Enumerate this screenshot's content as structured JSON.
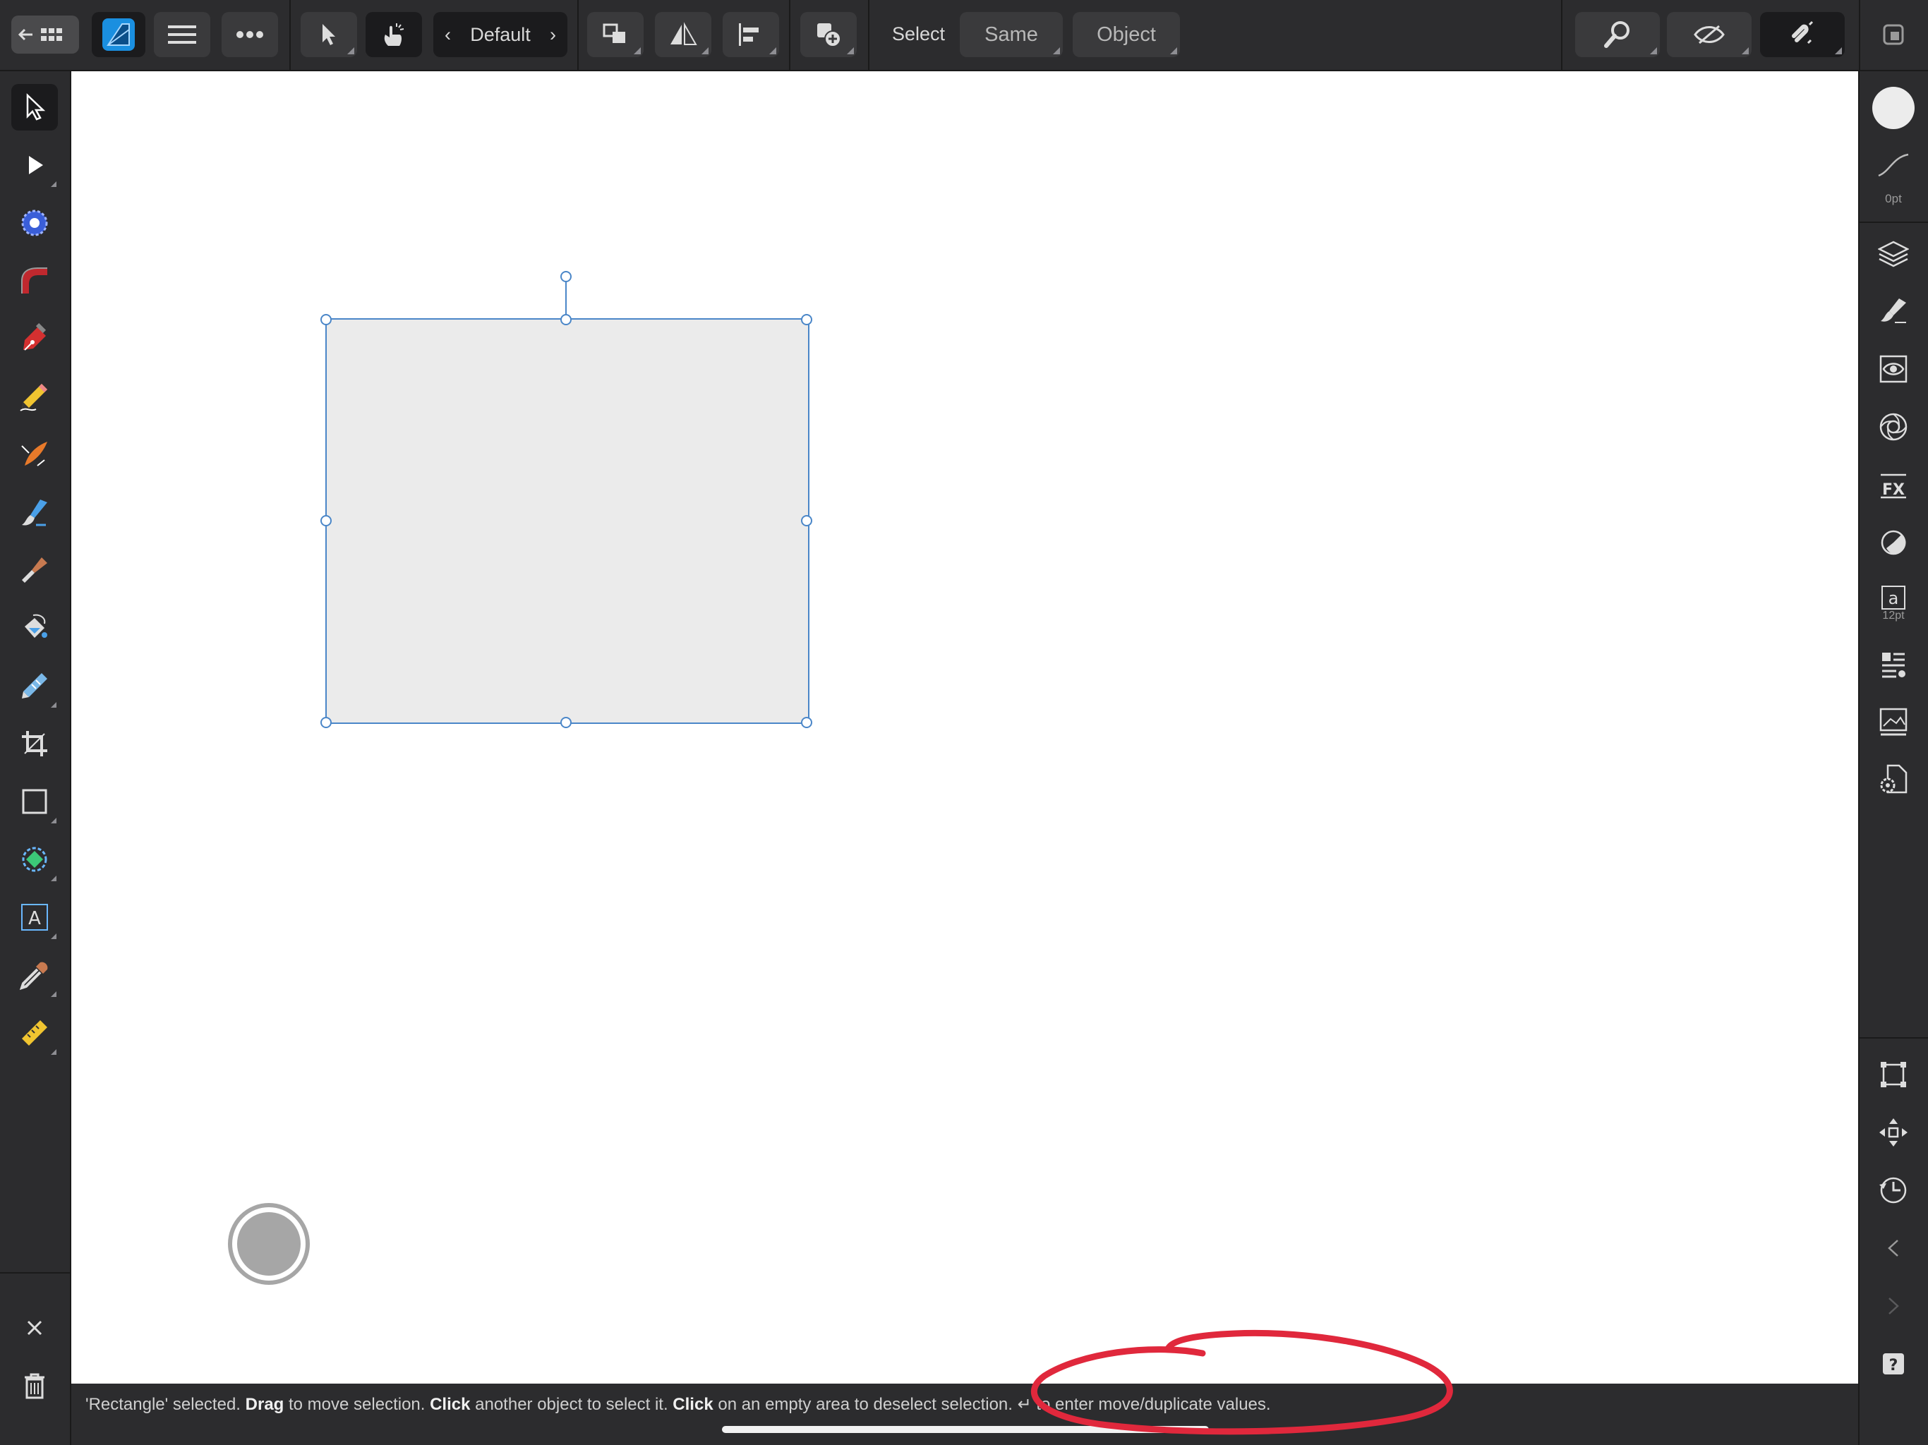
{
  "toolbar": {
    "context_label": "Default",
    "select_label": "Select",
    "same_label": "Same",
    "object_label": "Object"
  },
  "left_tools": [
    "move-tool",
    "node-tool",
    "corner-tool",
    "point-transform-tool",
    "pen-tool",
    "pencil-tool",
    "vector-brush-tool",
    "fill-tool",
    "paint-brush-tool",
    "transparency-tool",
    "shape-builder-tool",
    "crop-tool",
    "rectangle-tool",
    "vector-crop-tool",
    "artistic-text-tool",
    "color-picker-tool",
    "measure-tool"
  ],
  "right_panel": {
    "stroke_width": "0pt",
    "text_size": "12pt"
  },
  "canvas": {
    "selected_object": "Rectangle",
    "rect_fill": "#ebebeb",
    "selection_color": "#4a86c8"
  },
  "status": {
    "p1": "'Rectangle' selected. ",
    "b1": "Drag",
    "p2": " to move selection. ",
    "b2": "Click",
    "p3": " another object to select it. ",
    "b3": "Click",
    "p4": " on an empty area to deselect selection. ",
    "p5": " to enter move/duplicate values."
  },
  "colors": {
    "accent": "#1a8fe0",
    "annotation": "#e0283c"
  }
}
